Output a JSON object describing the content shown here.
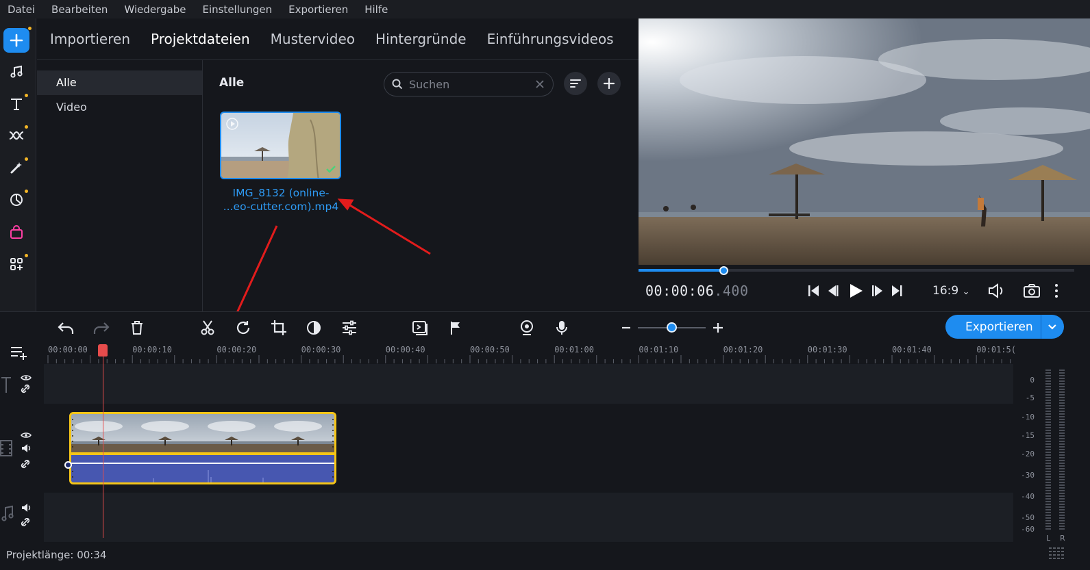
{
  "menu": [
    "Datei",
    "Bearbeiten",
    "Wiedergabe",
    "Einstellungen",
    "Exportieren",
    "Hilfe"
  ],
  "tabs": [
    {
      "label": "Importieren",
      "active": false
    },
    {
      "label": "Projektdateien",
      "active": true
    },
    {
      "label": "Mustervideo",
      "active": false
    },
    {
      "label": "Hintergründe",
      "active": false
    },
    {
      "label": "Einführungsvideos",
      "active": false
    }
  ],
  "categories": [
    {
      "label": "Alle",
      "active": true
    },
    {
      "label": "Video",
      "active": false
    }
  ],
  "media": {
    "title": "Alle",
    "search_placeholder": "Suchen",
    "file_name_line1": "IMG_8132 (online-",
    "file_name_line2": "...eo-cutter.com).mp4"
  },
  "player": {
    "timecode_main": "00:00:06",
    "timecode_ms": ".400",
    "aspect_ratio": "16:9",
    "progress_fraction": 0.195
  },
  "toolbar": {
    "export_label": "Exportieren",
    "zoom_fraction": 0.5
  },
  "timeline": {
    "ruler_labels": [
      "00:00:00",
      "00:00:10",
      "00:00:20",
      "00:00:30",
      "00:00:40",
      "00:00:50",
      "00:01:00",
      "00:01:10",
      "00:01:20",
      "00:01:30",
      "00:01:40",
      "00:01:5("
    ],
    "meter_db": [
      "0",
      "-5",
      "-10",
      "-15",
      "-20",
      "-30",
      "-40",
      "-50",
      "-60"
    ],
    "meter_channels": [
      "L",
      "R"
    ]
  },
  "status": {
    "project_length": "Projektlänge: 00:34"
  },
  "colors": {
    "accent": "#1e8cf0",
    "clip_border": "#f5c518",
    "playhead": "#e74c4c",
    "notify_dot": "#f3b526"
  }
}
